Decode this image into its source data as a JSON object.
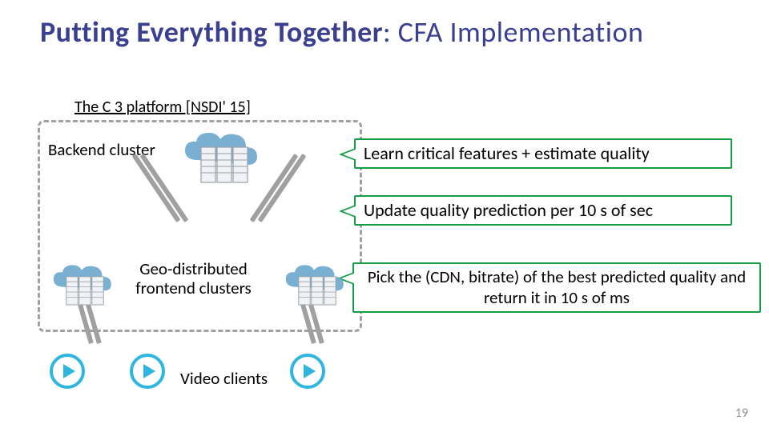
{
  "title": {
    "bold": "Putting Everything Together",
    "light": ": CFA Implementation"
  },
  "platform_label": "The C 3 platform [NSDI' 15]",
  "labels": {
    "backend": "Backend cluster",
    "frontend": "Geo-distributed frontend clusters",
    "clients": "Video clients"
  },
  "callouts": {
    "c1": "Learn critical features + estimate quality",
    "c2": "Update quality prediction per 10 s of sec",
    "c3": "Pick the (CDN, bitrate) of the best predicted quality and return it in 10 s of ms"
  },
  "page_number": "19",
  "colors": {
    "title": "#3b3f8f",
    "callout_border": "#169b47",
    "dash": "#a0a0a0",
    "cloud": "#5a9cc8",
    "server_fill": "#eceff3",
    "server_stroke": "#b0b6bd",
    "play": "#2eb6e0"
  }
}
